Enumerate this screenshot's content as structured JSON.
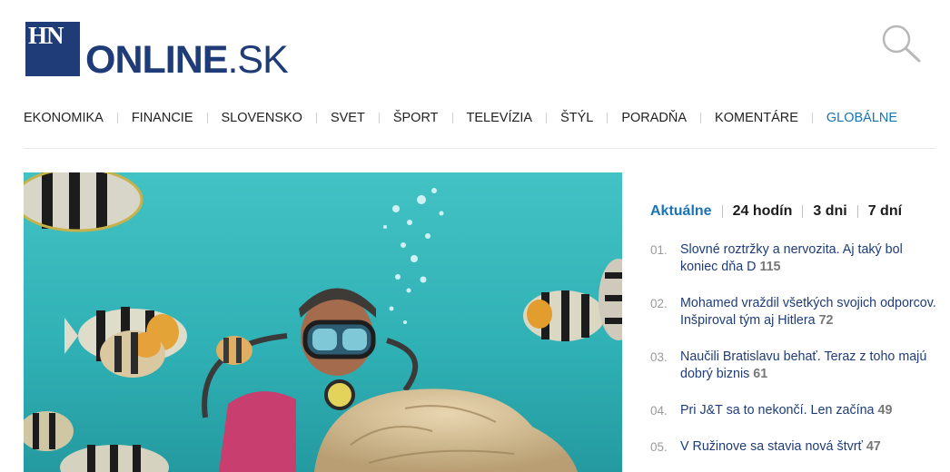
{
  "header": {
    "logo_mark": "HN",
    "logo_main": "ONLINE",
    "logo_suffix": ".SK",
    "brand_color": "#1f3c78",
    "search_icon": "search-icon"
  },
  "nav": {
    "items": [
      {
        "label": "EKONOMIKA"
      },
      {
        "label": "FINANCIE"
      },
      {
        "label": "SLOVENSKO"
      },
      {
        "label": "SVET"
      },
      {
        "label": "ŠPORT"
      },
      {
        "label": "TELEVÍZIA"
      },
      {
        "label": "ŠTÝL"
      },
      {
        "label": "PORADŇA"
      },
      {
        "label": "KOMENTÁRE"
      },
      {
        "label": "GLOBÁLNE"
      }
    ],
    "active_index": 9,
    "active_color": "#1a73b5"
  },
  "hero": {
    "image": "underwater-diver-with-tropical-fish"
  },
  "popular": {
    "tabs": [
      {
        "label": "Aktuálne"
      },
      {
        "label": "24 hodín"
      },
      {
        "label": "3 dni"
      },
      {
        "label": "7 dní"
      }
    ],
    "active_tab": 0,
    "items": [
      {
        "num": "01.",
        "title": "Slovné roztržky a nervozita. Aj taký bol koniec dňa D",
        "count": "115"
      },
      {
        "num": "02.",
        "title": "Mohamed vraždil všetkých svojich odporcov. Inšpiroval tým aj Hitlera",
        "count": "72"
      },
      {
        "num": "03.",
        "title": "Naučili Bratislavu behať. Teraz z toho majú dobrý biznis",
        "count": "61"
      },
      {
        "num": "04.",
        "title": "Pri J&T sa to nekončí. Len začína",
        "count": "49"
      },
      {
        "num": "05.",
        "title": "V Ružinove sa stavia nová štvrť",
        "count": "47"
      }
    ]
  }
}
